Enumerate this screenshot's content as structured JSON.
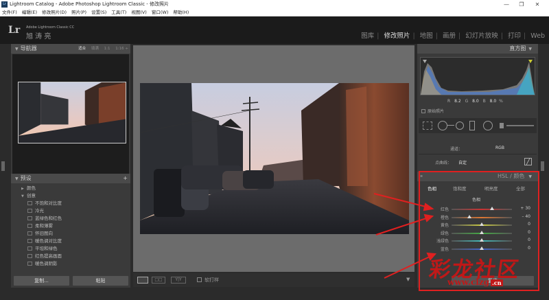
{
  "window": {
    "app_icon": "Lr",
    "title": "Lightroom Catalog - Adobe Photoshop Lightroom Classic - 修改照片",
    "minimize": "—",
    "maximize": "❐",
    "close": "✕"
  },
  "menu": [
    "文件(F)",
    "编辑(E)",
    "修改照片(D)",
    "照片(P)",
    "设置(S)",
    "工具(T)",
    "视图(V)",
    "窗口(W)",
    "帮助(H)"
  ],
  "identity": {
    "logo": "Lr",
    "product": "Adobe Lightroom Classic CC",
    "user": "旭 涛 亮"
  },
  "modules": [
    "图库",
    "修改照片",
    "地图",
    "画册",
    "幻灯片放映",
    "打印",
    "Web"
  ],
  "active_module": "修改照片",
  "navigator": {
    "title": "导航器",
    "zoom": [
      "适合",
      "填满",
      "1:1",
      "1:16 ÷"
    ]
  },
  "presets": {
    "title": "预设",
    "add": "+",
    "items": [
      {
        "label": "颜色",
        "type": "folder",
        "expanded": false
      },
      {
        "label": "创意",
        "type": "folder",
        "expanded": true
      },
      {
        "label": "不饱和对比度",
        "type": "preset"
      },
      {
        "label": "冷光",
        "type": "preset"
      },
      {
        "label": "蓝绿色和红色",
        "type": "preset"
      },
      {
        "label": "柔和薄雾",
        "type": "preset"
      },
      {
        "label": "怀旧图向",
        "type": "preset"
      },
      {
        "label": "暖色调对比度",
        "type": "preset"
      },
      {
        "label": "平坦和绿色",
        "type": "preset"
      },
      {
        "label": "红色提高画面",
        "type": "preset"
      },
      {
        "label": "暖色调阴影",
        "type": "preset"
      }
    ]
  },
  "left_buttons": {
    "copy": "复制...",
    "paste": "粘贴"
  },
  "toolbar": {
    "soft_proof": "软打样",
    "view_xy": "Y|Y"
  },
  "histogram": {
    "title": "直方图",
    "r_label": "R",
    "r_value": "8.2",
    "g_label": "G",
    "g_value": "8.0",
    "b_label": "B",
    "b_value": "8.0",
    "percent": "%",
    "original_photo": "原始照片"
  },
  "tone_curve": {
    "channel_label": "通道：",
    "channel_value": "RGB",
    "point_curve_label": "点曲线：",
    "point_curve_value": "自定"
  },
  "hsl": {
    "title": "HSL / 颜色",
    "tabs": [
      "色相",
      "饱和度",
      "明亮度",
      "全部"
    ],
    "active_tab": "色相",
    "section": "色相",
    "sliders": [
      {
        "label": "红色",
        "value": "+ 30",
        "pos": 0.67
      },
      {
        "label": "橙色",
        "value": "– 40",
        "pos": 0.29
      },
      {
        "label": "黄色",
        "value": "0",
        "pos": 0.5
      },
      {
        "label": "绿色",
        "value": "0",
        "pos": 0.5
      },
      {
        "label": "浅绿色",
        "value": "0",
        "pos": 0.5
      },
      {
        "label": "蓝色",
        "value": "0",
        "pos": 0.5
      }
    ],
    "reset": "复位"
  },
  "watermark": {
    "text": "彩龙社区",
    "url": "www.clzg",
    "tld": ".cn"
  },
  "colors": {
    "accent_red": "#e02020",
    "panel_bg": "#3a3a3a",
    "header_bg": "#4a4a4a"
  }
}
